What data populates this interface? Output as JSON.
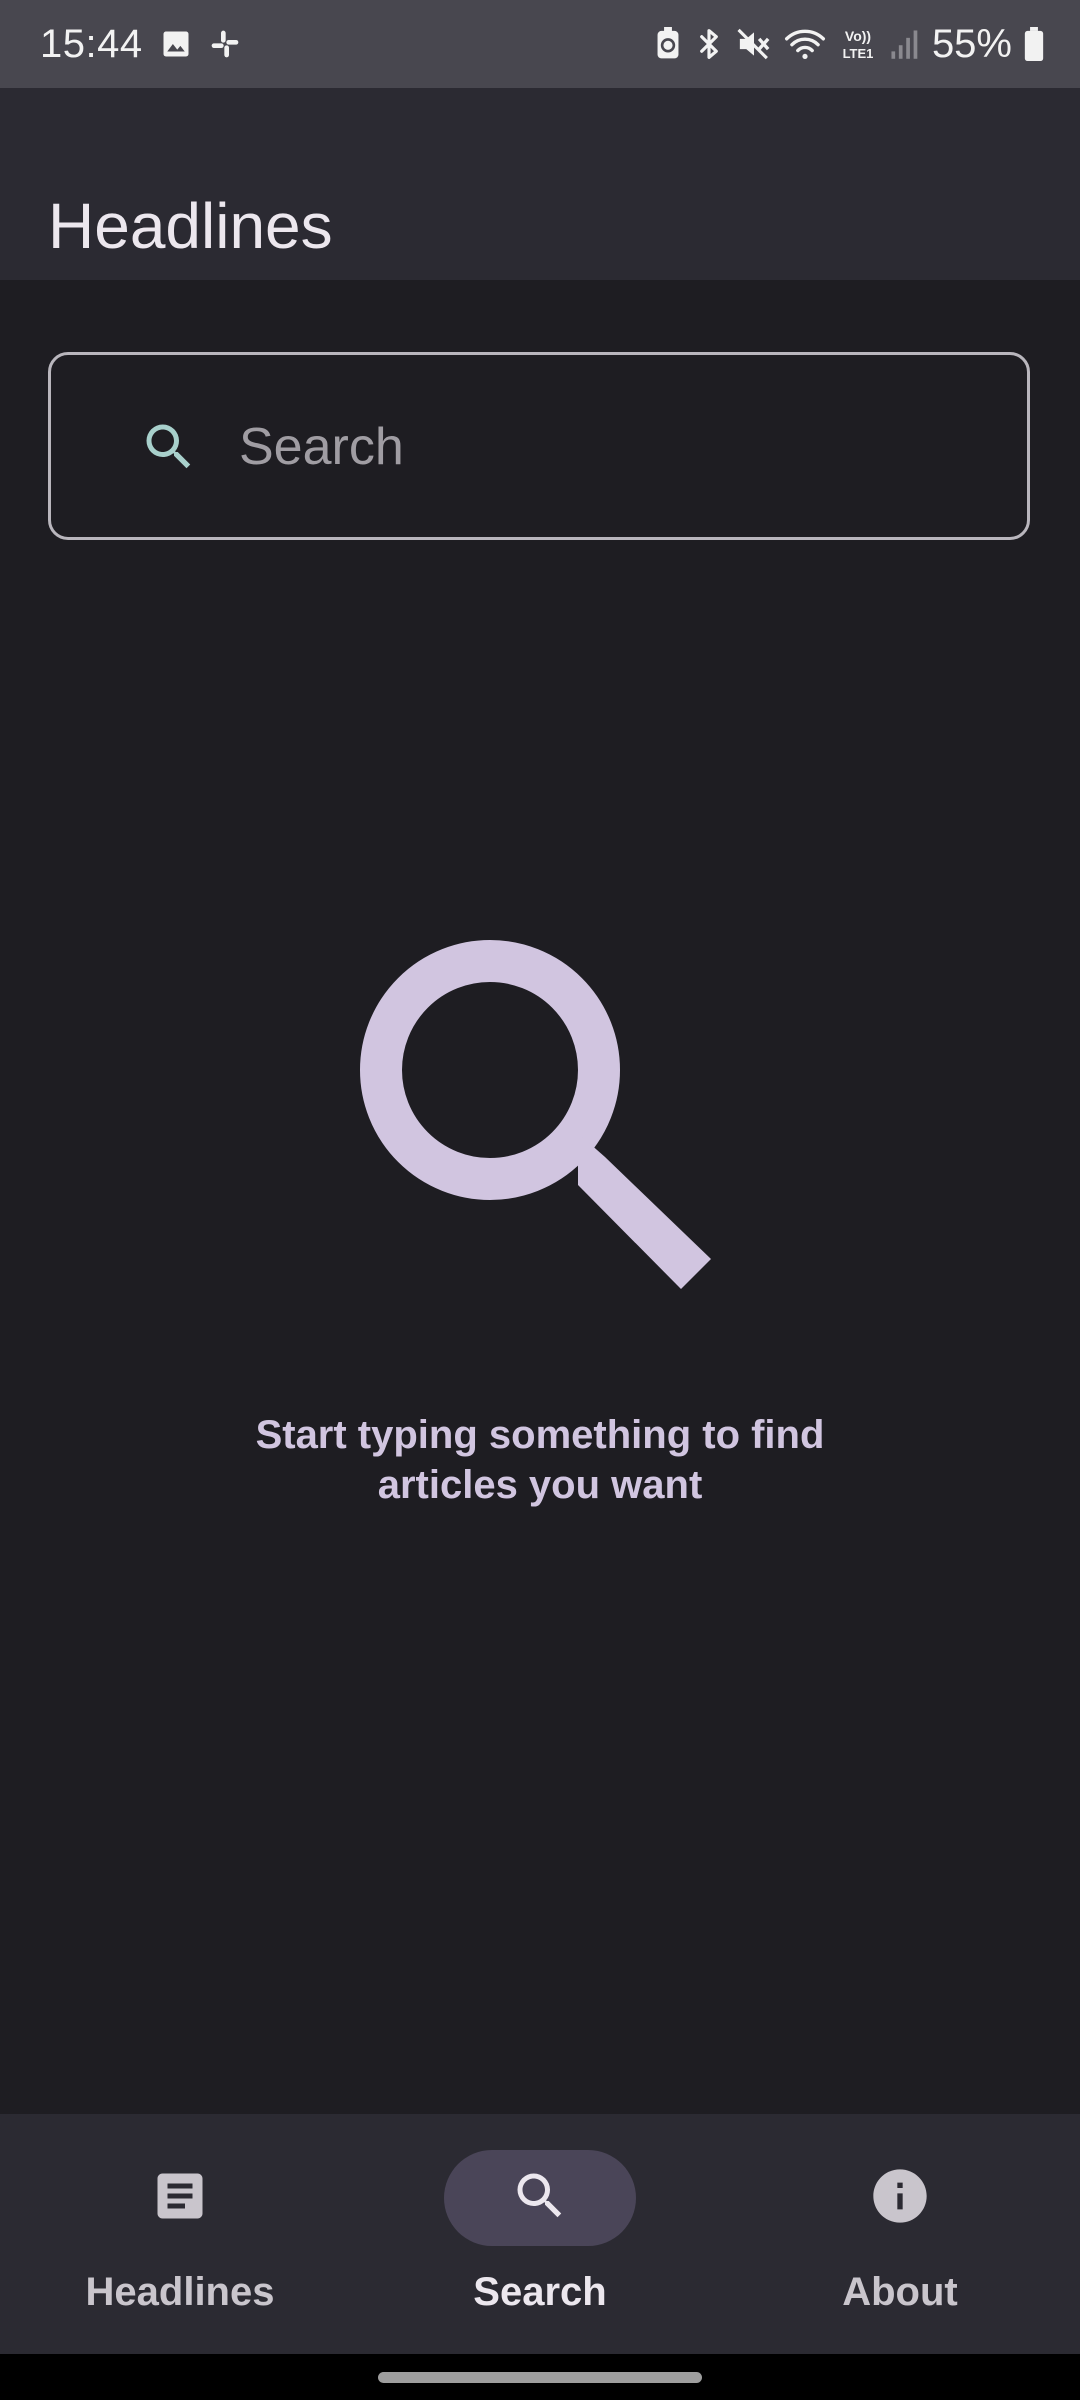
{
  "status_bar": {
    "time": "15:44",
    "battery_percent": "55%",
    "network_label": "Vo) LTE1",
    "left_icons": [
      "gallery-icon",
      "slack-icon"
    ],
    "right_icons": [
      "battery-saver-icon",
      "bluetooth-icon",
      "mute-icon",
      "wifi-icon",
      "volte-icon",
      "signal-icon",
      "battery-icon"
    ]
  },
  "app_bar": {
    "title": "Headlines"
  },
  "search": {
    "placeholder": "Search",
    "value": "",
    "icon": "search-icon"
  },
  "empty_state": {
    "icon": "search-icon",
    "message": "Start typing something to find\narticles you want"
  },
  "bottom_nav": {
    "active": "search",
    "items": [
      {
        "id": "headlines",
        "label": "Headlines",
        "icon": "article-icon"
      },
      {
        "id": "search",
        "label": "Search",
        "icon": "search-icon"
      },
      {
        "id": "about",
        "label": "About",
        "icon": "info-icon"
      }
    ]
  },
  "colors": {
    "background": "#1e1d22",
    "surface": "#2b2a32",
    "status_bar": "#48474f",
    "accent": "#d1c5e0",
    "active_pill": "#4a4558",
    "search_icon_tint": "#a8d0cc"
  }
}
